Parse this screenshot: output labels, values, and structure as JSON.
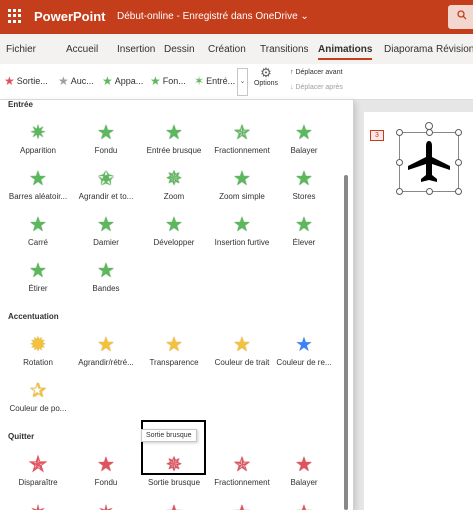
{
  "titlebar": {
    "app_name": "PowerPoint",
    "doc_title": "Début-online - Enregistré dans OneDrive ⌄",
    "search_icon": "search-icon"
  },
  "tabs": [
    "Fichier",
    "Accueil",
    "Insertion",
    "Dessin",
    "Création",
    "Transitions",
    "Animations",
    "Diaporama",
    "Révision"
  ],
  "active_tab": "Animations",
  "ribbon": {
    "effects": [
      "Sortie...",
      "Auc...",
      "Appa...",
      "Fon...",
      "Entré..."
    ],
    "options_label": "Options",
    "move_forward": "Déplacer avant",
    "move_back": "Déplacer après"
  },
  "gallery": {
    "sections": {
      "entree": "Entrée",
      "accentuation": "Accentuation",
      "quitter": "Quitter"
    },
    "entree_items": [
      "Apparition",
      "Fondu",
      "Entrée brusque",
      "Fractionnement",
      "Balayer",
      "Barres aléatoir...",
      "Agrandir et to...",
      "Zoom",
      "Zoom simple",
      "Stores",
      "Carré",
      "Damier",
      "Développer",
      "Insertion furtive",
      "Élever",
      "Étirer",
      "Bandes"
    ],
    "accent_items": [
      "Rotation",
      "Agrandir/rétré...",
      "Transparence",
      "Couleur de trait",
      "Couleur de re...",
      "Couleur de po..."
    ],
    "quitter_items": [
      "Disparaître",
      "Fondu",
      "Sortie brusque",
      "Fractionnement",
      "Balayer"
    ],
    "tooltip": "Sortie brusque"
  },
  "slide": {
    "number": "3"
  },
  "colors": {
    "brand": "#c43e1c",
    "entree": "#5cb85c",
    "accent": "#f3c13a",
    "quitter": "#e0525c"
  }
}
